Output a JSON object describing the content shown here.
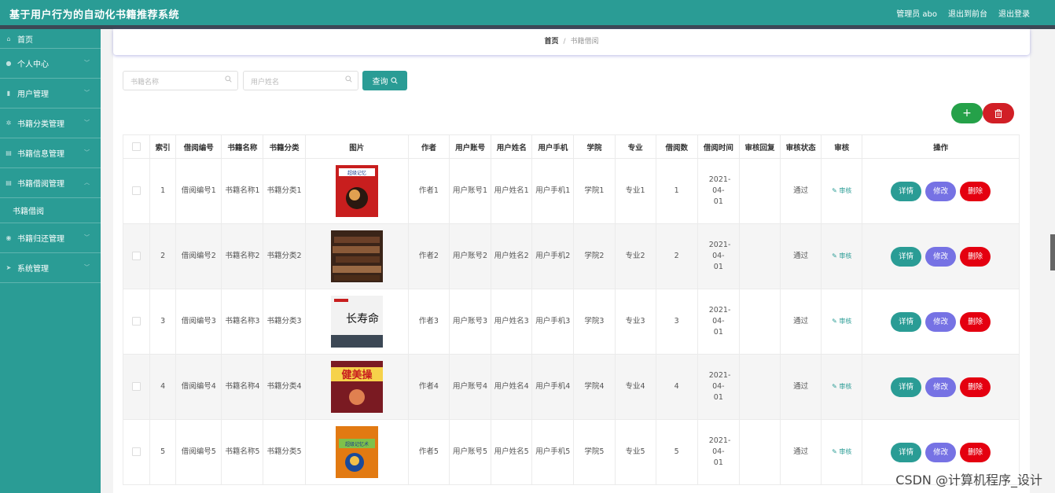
{
  "header": {
    "title": "基于用户行为的自动化书籍推荐系统",
    "admin": "管理员 abo",
    "front": "退出到前台",
    "logout": "退出登录"
  },
  "sidebar": {
    "home": "首页",
    "items": [
      "个人中心",
      "用户管理",
      "书籍分类管理",
      "书籍信息管理",
      "书籍借阅管理"
    ],
    "sub": "书籍借阅",
    "items2": [
      "书籍归还管理",
      "系统管理"
    ]
  },
  "breadcrumb": {
    "home": "首页",
    "sep": "/",
    "current": "书籍借阅"
  },
  "search": {
    "book_placeholder": "书籍名称",
    "user_placeholder": "用户姓名",
    "button": "查询"
  },
  "table": {
    "headers": [
      "索引",
      "借阅编号",
      "书籍名称",
      "书籍分类",
      "图片",
      "作者",
      "用户账号",
      "用户姓名",
      "用户手机",
      "学院",
      "专业",
      "借阅数",
      "借阅时间",
      "审核回复",
      "审核状态",
      "审核",
      "操作"
    ],
    "rows": [
      {
        "idx": "1",
        "no": "借阅编号1",
        "name": "书籍名称1",
        "cat": "书籍分类1",
        "author": "作者1",
        "acc": "用户账号1",
        "uname": "用户姓名1",
        "phone": "用户手机1",
        "college": "学院1",
        "major": "专业1",
        "count": "1",
        "time": "2021-04-01",
        "reply": "",
        "status": "通过",
        "audit": "审核"
      },
      {
        "idx": "2",
        "no": "借阅编号2",
        "name": "书籍名称2",
        "cat": "书籍分类2",
        "author": "作者2",
        "acc": "用户账号2",
        "uname": "用户姓名2",
        "phone": "用户手机2",
        "college": "学院2",
        "major": "专业2",
        "count": "2",
        "time": "2021-04-01",
        "reply": "",
        "status": "通过",
        "audit": "审核"
      },
      {
        "idx": "3",
        "no": "借阅编号3",
        "name": "书籍名称3",
        "cat": "书籍分类3",
        "author": "作者3",
        "acc": "用户账号3",
        "uname": "用户姓名3",
        "phone": "用户手机3",
        "college": "学院3",
        "major": "专业3",
        "count": "3",
        "time": "2021-04-01",
        "reply": "",
        "status": "通过",
        "audit": "审核"
      },
      {
        "idx": "4",
        "no": "借阅编号4",
        "name": "书籍名称4",
        "cat": "书籍分类4",
        "author": "作者4",
        "acc": "用户账号4",
        "uname": "用户姓名4",
        "phone": "用户手机4",
        "college": "学院4",
        "major": "专业4",
        "count": "4",
        "time": "2021-04-01",
        "reply": "",
        "status": "通过",
        "audit": "审核"
      },
      {
        "idx": "5",
        "no": "借阅编号5",
        "name": "书籍名称5",
        "cat": "书籍分类5",
        "author": "作者5",
        "acc": "用户账号5",
        "uname": "用户姓名5",
        "phone": "用户手机5",
        "college": "学院5",
        "major": "专业5",
        "count": "5",
        "time": "2021-04-01",
        "reply": "",
        "status": "通过",
        "audit": "审核"
      }
    ],
    "actions": {
      "detail": "详情",
      "edit": "修改",
      "delete": "删除"
    }
  },
  "covers": {
    "r1_title": "超级记忆",
    "r3_title": "长寿命",
    "r4_title": "健美操",
    "r5_title": "超级记忆术"
  },
  "watermark": "CSDN @计算机程序_设计"
}
